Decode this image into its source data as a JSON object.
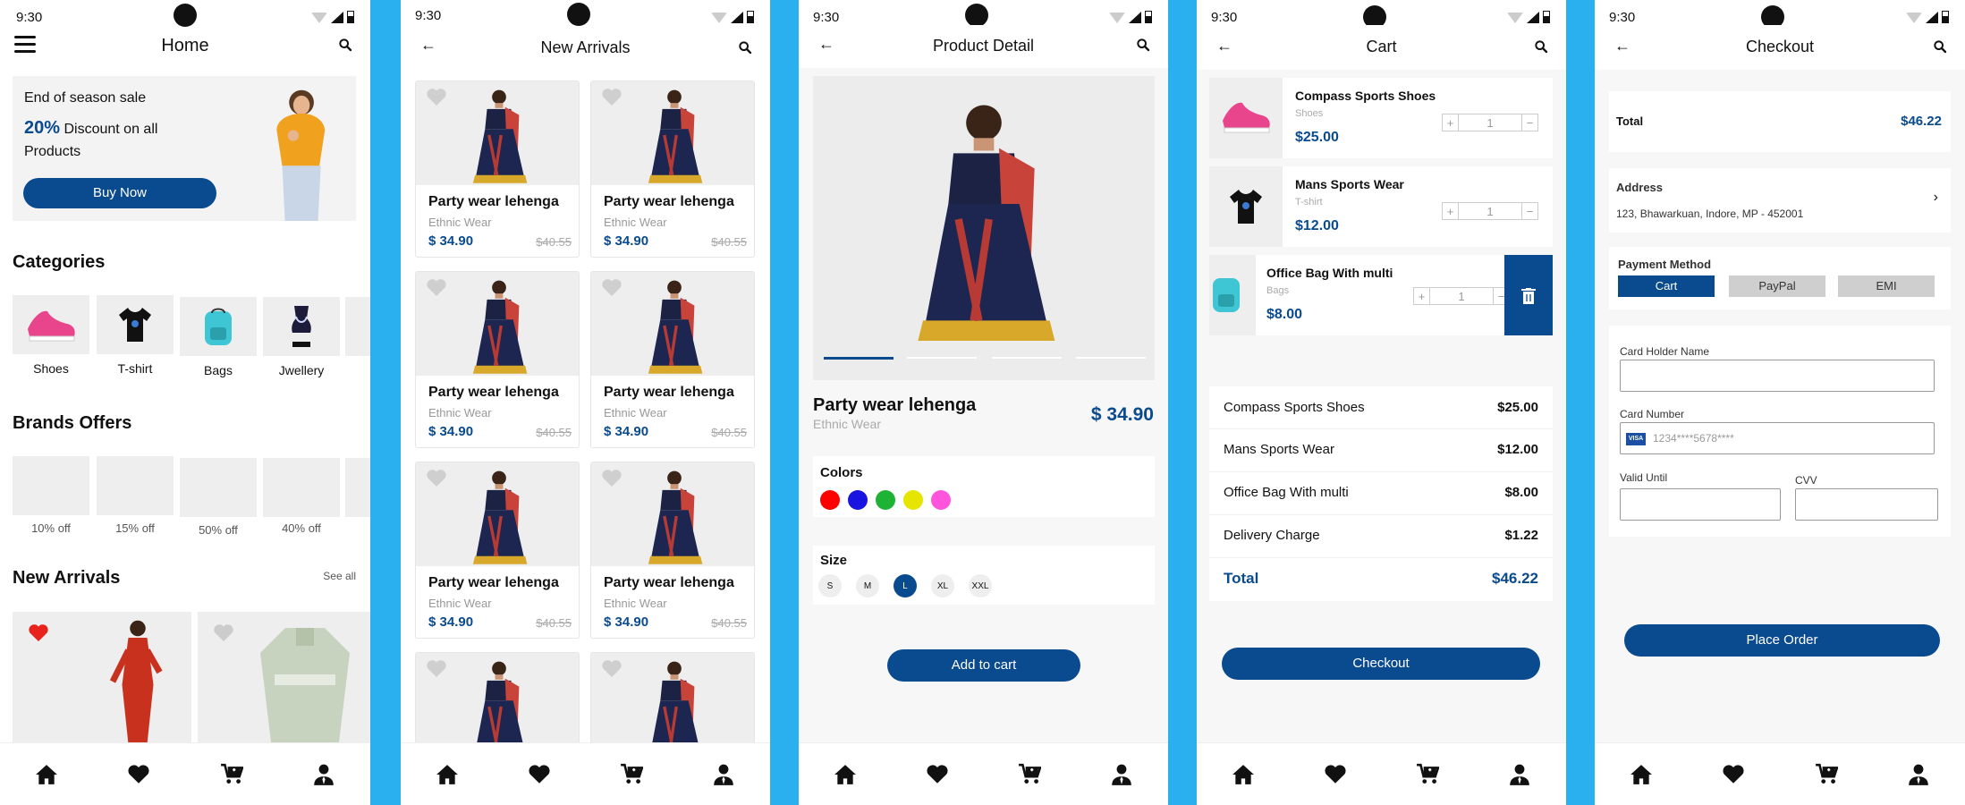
{
  "status": {
    "time": "9:30"
  },
  "nav_icons": [
    "home-icon",
    "heart-icon",
    "cart-icon",
    "profile-icon"
  ],
  "colors": {
    "brand": "#0a4a8f",
    "bg": "#2ab0ee",
    "heart_active": "#e8231e"
  },
  "home": {
    "title": "Home",
    "banner": {
      "line1": "End of season sale",
      "percent": "20%",
      "line2": " Discount on all",
      "line3": "Products",
      "button": "Buy Now"
    },
    "categories_title": "Categories",
    "categories": [
      "Shoes",
      "T-shirt",
      "Bags",
      "Jwellery"
    ],
    "brands_title": "Brands Offers",
    "brands": [
      "10% off",
      "15% off",
      "50% off",
      "40% off"
    ],
    "arrivals_title": "New Arrivals",
    "see_all": "See all"
  },
  "arrivals": {
    "title": "New Arrivals",
    "product": {
      "name": "Party wear lehenga",
      "category": "Ethnic Wear",
      "price": "$ 34.90",
      "old_price": "$40.55"
    }
  },
  "detail": {
    "title": "Product Detail",
    "name": "Party wear lehenga",
    "category": "Ethnic Wear",
    "price": "$ 34.90",
    "colors_label": "Colors",
    "colors": [
      "#ff0000",
      "#1a14e0",
      "#1fb336",
      "#e5e500",
      "#ff55dd"
    ],
    "size_label": "Size",
    "sizes": [
      "S",
      "M",
      "L",
      "XL",
      "XXL"
    ],
    "selected_size": "L",
    "add_to_cart": "Add to cart"
  },
  "cart": {
    "title": "Cart",
    "items": [
      {
        "name": "Compass Sports Shoes",
        "category": "Shoes",
        "price": "$25.00",
        "qty": "1"
      },
      {
        "name": "Mans Sports Wear",
        "category": "T-shirt",
        "price": "$12.00",
        "qty": "1"
      },
      {
        "name": "Office Bag With multi",
        "category": "Bags",
        "price": "$8.00",
        "qty": "1"
      }
    ],
    "summary": [
      {
        "label": "Compass Sports Shoes",
        "value": "$25.00"
      },
      {
        "label": "Mans Sports Wear",
        "value": "$12.00"
      },
      {
        "label": "Office Bag With multi",
        "value": "$8.00"
      },
      {
        "label": "Delivery Charge",
        "value": "$1.22"
      }
    ],
    "total_label": "Total",
    "total_value": "$46.22",
    "checkout": "Checkout"
  },
  "checkout": {
    "title": "Checkout",
    "total_label": "Total",
    "total_value": "$46.22",
    "address_label": "Address",
    "address": "123, Bhawarkuan, Indore, MP - 452001",
    "payment_label": "Payment Method",
    "payment_options": [
      "Cart",
      "PayPal",
      "EMI"
    ],
    "card_holder_label": "Card Holder Name",
    "card_number_label": "Card Number",
    "card_brand": "VISA",
    "card_number_placeholder": "1234****5678****",
    "valid_label": "Valid Until",
    "cvv_label": "CVV",
    "place_order": "Place Order"
  }
}
